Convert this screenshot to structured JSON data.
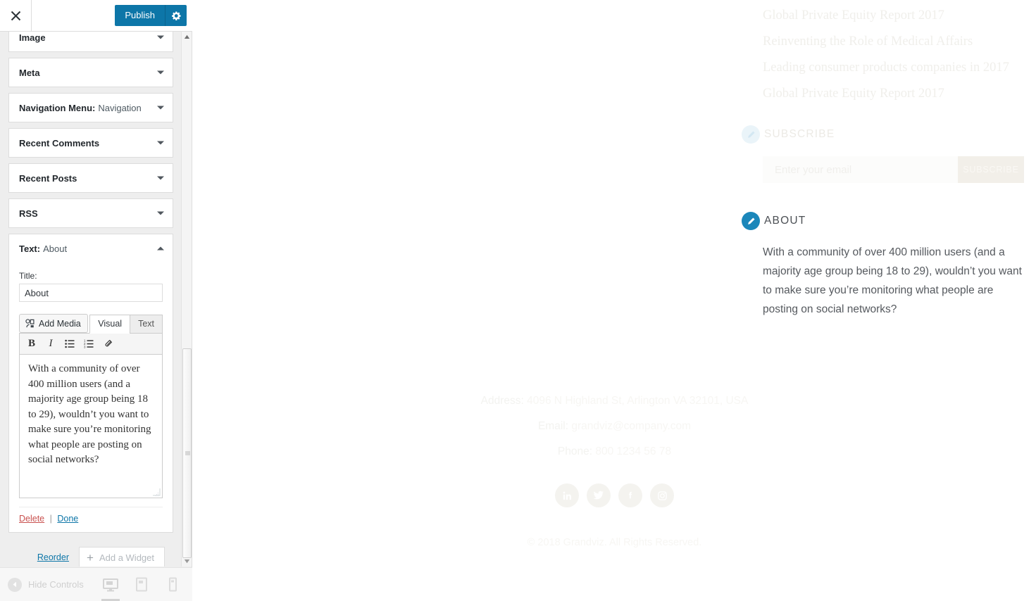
{
  "customizer": {
    "close_label": "Close",
    "publish_label": "Publish",
    "gear_label": "gear-icon",
    "widgets": [
      {
        "name": "Image",
        "value": "",
        "expanded": false
      },
      {
        "name": "Meta",
        "value": "",
        "expanded": false
      },
      {
        "name": "Navigation Menu:",
        "value": "Navigation",
        "expanded": false
      },
      {
        "name": "Recent Comments",
        "value": "",
        "expanded": false
      },
      {
        "name": "Recent Posts",
        "value": "",
        "expanded": false
      },
      {
        "name": "RSS",
        "value": "",
        "expanded": false
      },
      {
        "name": "Text:",
        "value": "About",
        "expanded": true
      }
    ],
    "text_widget": {
      "title_label": "Title:",
      "title_value": "About",
      "add_media_label": "Add Media",
      "tabs": [
        {
          "label": "Visual",
          "active": true
        },
        {
          "label": "Text",
          "active": false
        }
      ],
      "toolbar": [
        {
          "name": "bold-icon",
          "glyph": "B"
        },
        {
          "name": "italic-icon",
          "glyph": "I"
        },
        {
          "name": "unordered-list-icon",
          "glyph": ""
        },
        {
          "name": "ordered-list-icon",
          "glyph": ""
        },
        {
          "name": "link-icon",
          "glyph": ""
        }
      ],
      "content": "With a community of over 400 million users (and a majority age group being 18 to 29), wouldn’t you want to make sure you’re monitoring what people are posting on social networks?",
      "delete_label": "Delete",
      "separator": "|",
      "done_label": "Done"
    },
    "reorder_label": "Reorder",
    "add_widget_label": "Add a Widget",
    "hide_controls_label": "Hide Controls",
    "devices": [
      {
        "name": "desktop",
        "active": true
      },
      {
        "name": "tablet",
        "active": false
      },
      {
        "name": "mobile",
        "active": false
      }
    ]
  },
  "preview": {
    "recent_posts": [
      "Global Private Equity Report 2017",
      "Reinventing the Role of Medical Affairs",
      "Leading consumer products companies in 2017",
      "Global Private Equity Report 2017"
    ],
    "subscribe": {
      "heading": "SUBSCRIBE",
      "input_placeholder": "Enter your email",
      "input_value": "",
      "button_label": "SUBSCRIBE"
    },
    "about": {
      "heading": "ABOUT",
      "body": "With a community of over 400 million users (and a majority age group being 18 to 29), wouldn’t you want to make sure you’re monitoring what people are posting on social networks?"
    },
    "contact": {
      "address_label": "Address:",
      "address_value": "4096 N Highland St, Arlington VA 32101, USA",
      "email_label": "Email:",
      "email_value": "grandviz@company.com",
      "phone_label": "Phone:",
      "phone_value": "800 1234 56 78"
    },
    "socials": [
      {
        "name": "linkedin-icon"
      },
      {
        "name": "twitter-icon"
      },
      {
        "name": "facebook-icon"
      },
      {
        "name": "instagram-icon"
      }
    ],
    "copyright": "© 2018 Grandviz. All Rights Reserved."
  },
  "colors": {
    "wp_blue": "#0d76a8",
    "edit_pencil": "#1b87ba",
    "delete_red": "#c9514f",
    "sidebar_bg": "#eeeeee"
  }
}
